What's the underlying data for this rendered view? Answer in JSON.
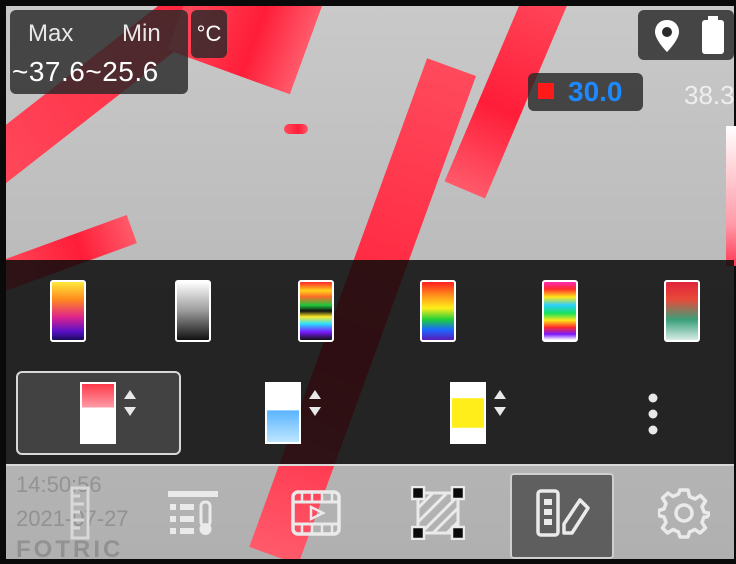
{
  "readout": {
    "max_label": "Max",
    "min_label": "Min",
    "range_text": "~37.6~25.6",
    "unit": "°C"
  },
  "spot": {
    "value": "30.0",
    "marker_color": "#ff1a1a",
    "value_color": "#1e88ff"
  },
  "scale": {
    "top_value": "38.3"
  },
  "palettes": [
    {
      "icon": "palette-iron-icon"
    },
    {
      "icon": "palette-white-hot-icon"
    },
    {
      "icon": "palette-rainbow-high-contrast-icon"
    },
    {
      "icon": "palette-rainbow-icon"
    },
    {
      "icon": "palette-multi-band-icon"
    },
    {
      "icon": "palette-red-green-icon"
    }
  ],
  "modes": [
    {
      "icon": "isotherm-above-icon",
      "selected": true
    },
    {
      "icon": "isotherm-below-icon",
      "selected": false
    },
    {
      "icon": "isotherm-interval-icon",
      "selected": false
    },
    {
      "icon": "more-icon",
      "selected": false
    }
  ],
  "toolbar": [
    {
      "icon": "ruler-icon"
    },
    {
      "icon": "thermometer-list-icon"
    },
    {
      "icon": "video-icon"
    },
    {
      "icon": "area-measure-icon"
    },
    {
      "icon": "palette-edit-icon",
      "selected": true
    },
    {
      "icon": "gear-icon"
    }
  ],
  "watermark": {
    "time": "14:50:56",
    "date": "2021-07-27",
    "brand": "FOTRIC"
  },
  "colors": {
    "hot": "#ff1d38",
    "background": "#bdbdbd"
  }
}
